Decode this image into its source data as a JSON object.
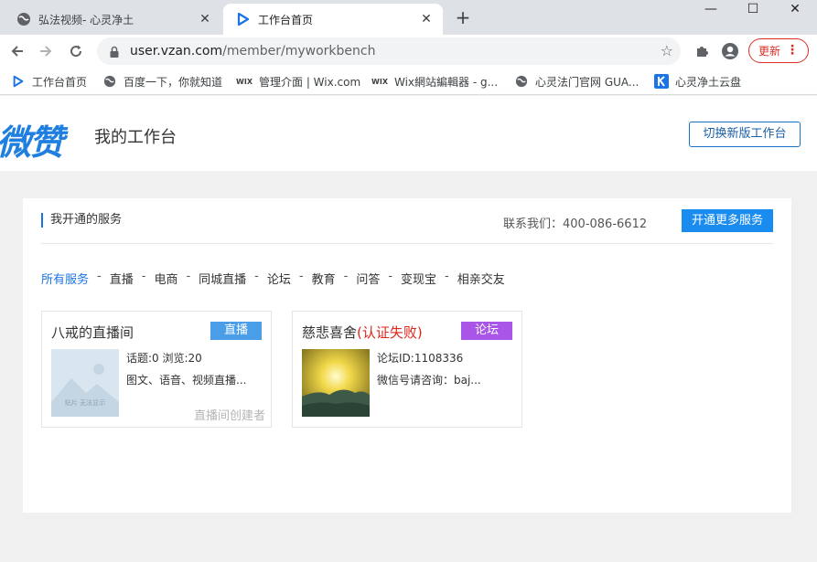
{
  "browser": {
    "tabs": [
      {
        "title": "弘法视频- 心灵净土",
        "active": false
      },
      {
        "title": "工作台首页",
        "active": true
      }
    ],
    "new_tab": "+",
    "window_controls": {
      "minimize": "—",
      "maximize": "☐",
      "close": "✕"
    },
    "url_host": "user.vzan.com",
    "url_path": "/member/myworkbench",
    "update_label": "更新",
    "bookmarks": [
      {
        "label": "工作台首页",
        "icon": "vzan-icon"
      },
      {
        "label": "百度一下，你就知道",
        "icon": "globe-icon"
      },
      {
        "label": "管理介面 | Wix.com",
        "icon": "wix-icon"
      },
      {
        "label": "Wix網站編輯器 - g...",
        "icon": "wix-icon"
      },
      {
        "label": "心灵法门官网 GUA...",
        "icon": "globe-icon"
      },
      {
        "label": "心灵净土云盘",
        "icon": "k-icon"
      }
    ]
  },
  "header": {
    "logo": "微赞",
    "title": "我的工作台",
    "switch_label": "切换新版工作台"
  },
  "panel": {
    "title": "我开通的服务",
    "contact_label": "联系我们：",
    "contact_phone": "400-086-6612",
    "more_label": "开通更多服务",
    "filters": [
      "所有服务",
      "直播",
      "电商",
      "同城直播",
      "论坛",
      "教育",
      "问答",
      "变现宝",
      "相亲交友"
    ],
    "separator": "-",
    "cards": [
      {
        "name": "八戒的直播间",
        "tag": "直播",
        "line1": "话题:0  浏览:20",
        "line2": "图文、语音、视频直播...",
        "thumb_caption": "贴片 无法显示",
        "footer": "直播间创建者"
      },
      {
        "name": "慈悲喜舍",
        "name_status": "(认证失败)",
        "tag": "论坛",
        "line1": "论坛ID:1108336",
        "line2": "微信号请咨询：baj..."
      }
    ]
  },
  "colors": {
    "accent": "#1a73e8",
    "live_tag": "#4a9ee8",
    "forum_tag": "#a855e8",
    "fail_text": "#e0251b",
    "update_red": "#d93025"
  }
}
